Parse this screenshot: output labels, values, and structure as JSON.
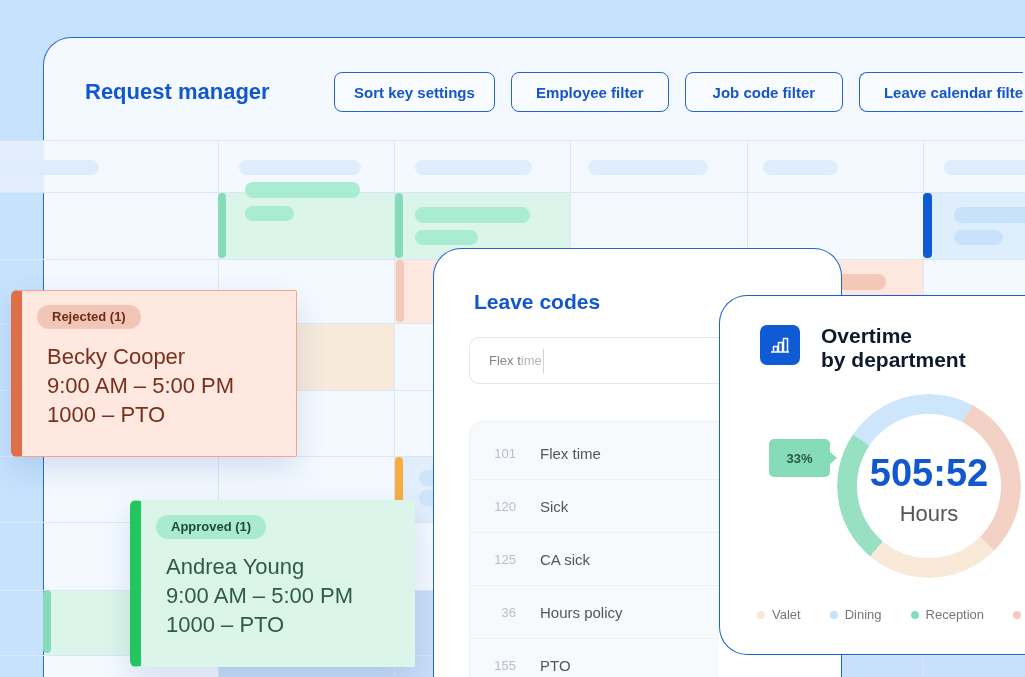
{
  "request_manager": {
    "title": "Request manager",
    "buttons": [
      "Sort key settings",
      "Employee filter",
      "Job code filter",
      "Leave calendar filte"
    ]
  },
  "requests": [
    {
      "kind": "rejected",
      "status": "Rejected (1)",
      "name": "Becky Cooper",
      "time": "9:00 AM – 5:00 PM",
      "code": "1000 – PTO"
    },
    {
      "kind": "approved",
      "status": "Approved (1)",
      "name": "Andrea Young",
      "time": "9:00 AM – 5:00 PM",
      "code": "1000 – PTO"
    }
  ],
  "leave_codes": {
    "title": "Leave codes",
    "search": {
      "value": "Flex t",
      "suggestion": "ime"
    },
    "rows": [
      {
        "code": "101",
        "name": "Flex time"
      },
      {
        "code": "120",
        "name": "Sick"
      },
      {
        "code": "125",
        "name": "CA sick"
      },
      {
        "code": "36",
        "name": "Hours policy"
      },
      {
        "code": "155",
        "name": "PTO"
      }
    ]
  },
  "overtime": {
    "title": "Overtime\nby department",
    "callout": "33%",
    "total": "505:52",
    "unit": "Hours",
    "legend": [
      {
        "label": "Valet",
        "color": "#f7e6d2"
      },
      {
        "label": "Dining",
        "color": "#c6e2fc"
      },
      {
        "label": "Reception",
        "color": "#86dcb8"
      },
      {
        "color": "#f2cbbb"
      }
    ]
  }
}
